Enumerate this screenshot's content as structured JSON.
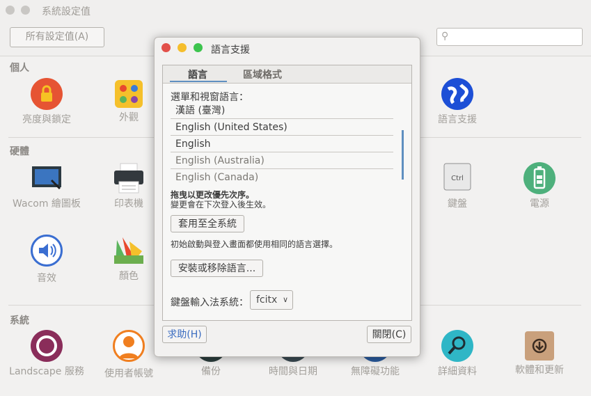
{
  "window": {
    "title": "系統設定值"
  },
  "toolbar": {
    "all_settings_label": "所有設定值(A)",
    "search_placeholder": ""
  },
  "sections": {
    "personal": "個人",
    "hardware": "硬體",
    "system": "系統"
  },
  "personal_items": [
    "亮度與鎖定",
    "外觀",
    "語言支援"
  ],
  "hardware_items": [
    "Wacom 繪圖板",
    "印表機",
    "鍵盤",
    "電源",
    "音效",
    "顏色"
  ],
  "system_items": [
    "Landscape 服務",
    "使用者帳號",
    "備份",
    "時間與日期",
    "無障礙功能",
    "詳細資料",
    "軟體和更新"
  ],
  "dialog": {
    "title": "語言支援",
    "tabs": [
      "語言",
      "區域格式"
    ],
    "menu_lang_label": "選單和視窗語言：",
    "languages": [
      "漢語 (臺灣)",
      "English (United States)",
      "English",
      "English (Australia)",
      "English (Canada)"
    ],
    "drag_hint": "拖曳以更改優先次序。",
    "login_hint": "變更會在下次登入後生效。",
    "apply_system_wide": "套用至全系統",
    "apply_desc": "初始啟動與登入畫面都使用相同的語言選擇。",
    "install_remove": "安裝或移除語言...",
    "im_system_label": "鍵盤輸入法系統：",
    "im_system_value": "fcitx",
    "help_button": "求助(H)",
    "close_button": "關閉(C)"
  },
  "colors": {
    "accent": "#5f8fc0",
    "close": "#e2504a",
    "minimize": "#f5be2c",
    "maximize": "#3dc44e"
  }
}
